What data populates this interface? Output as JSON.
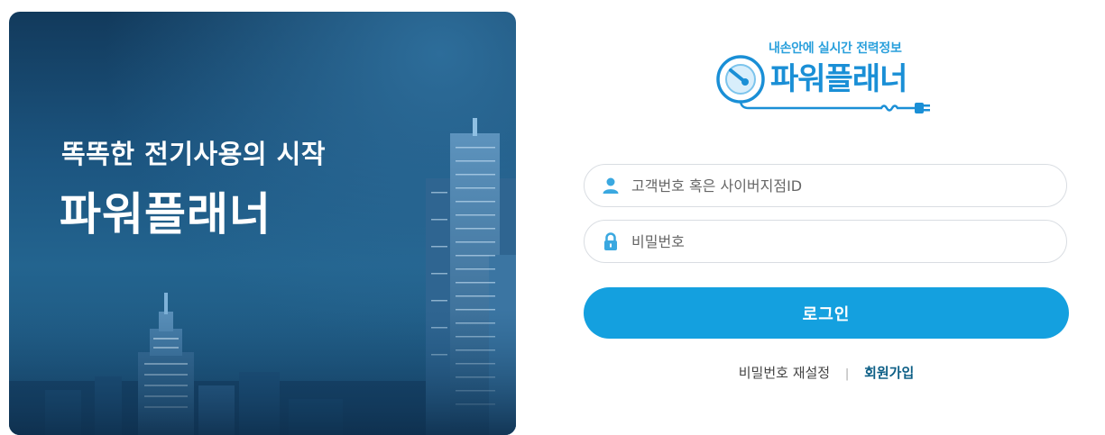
{
  "hero": {
    "subtitle": "똑똑한 전기사용의 시작",
    "title": "파워플래너"
  },
  "logo": {
    "tagline": "내손안에 실시간 전력정보",
    "name": "파워플래너",
    "icon": "gauge-plug-icon",
    "color": "#1a8fd6"
  },
  "form": {
    "id_placeholder": "고객번호 혹은 사이버지점ID",
    "id_icon": "user-icon",
    "password_placeholder": "비밀번호",
    "password_icon": "lock-icon",
    "login_label": "로그인",
    "accent_color": "#14a0df"
  },
  "links": {
    "reset_password": "비밀번호 재설정",
    "separator": "|",
    "signup": "회원가입"
  }
}
